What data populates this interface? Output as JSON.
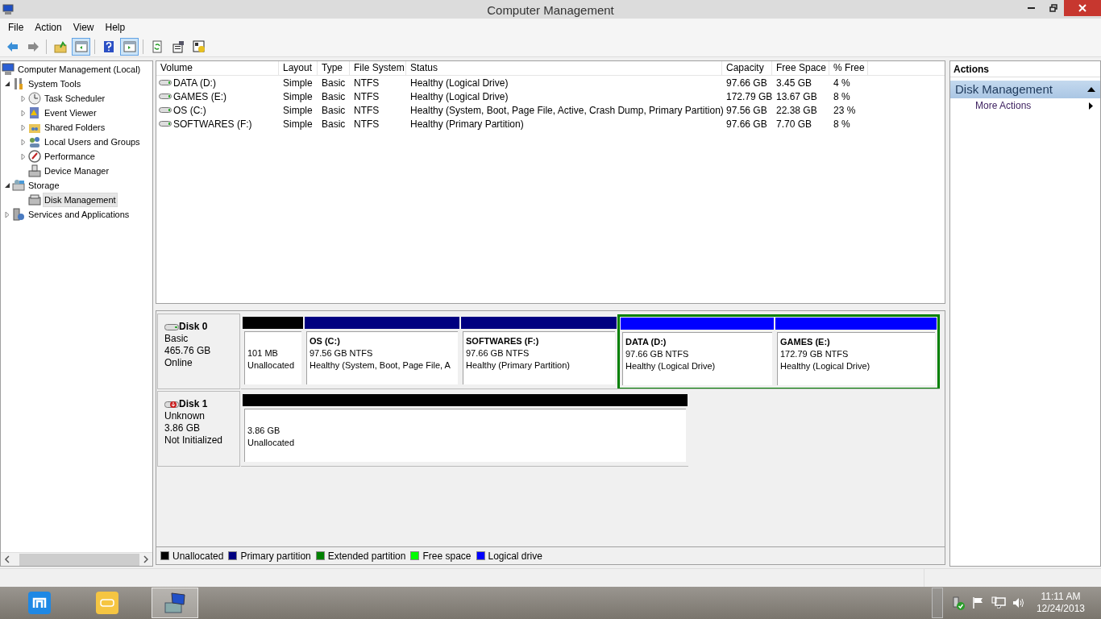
{
  "window": {
    "title": "Computer Management"
  },
  "menu": [
    "File",
    "Action",
    "View",
    "Help"
  ],
  "toolbar": [
    {
      "kind": "back",
      "pressed": false
    },
    {
      "kind": "forward",
      "pressed": false
    },
    {
      "kind": "sep"
    },
    {
      "kind": "up",
      "pressed": false
    },
    {
      "kind": "tree",
      "pressed": true
    },
    {
      "kind": "sep"
    },
    {
      "kind": "help",
      "pressed": false
    },
    {
      "kind": "pane",
      "pressed": true
    },
    {
      "kind": "sep"
    },
    {
      "kind": "refresh",
      "pressed": false
    },
    {
      "kind": "props",
      "pressed": false
    },
    {
      "kind": "settings",
      "pressed": false
    }
  ],
  "tree": [
    {
      "label": "Computer Management (Local)",
      "kind": "computer",
      "selected": false,
      "children": [
        {
          "label": "System Tools",
          "kind": "tools",
          "selected": false,
          "expanded": true,
          "children": [
            {
              "label": "Task Scheduler",
              "kind": "clock",
              "selected": false,
              "expanded": false
            },
            {
              "label": "Event Viewer",
              "kind": "log",
              "selected": false,
              "expanded": false
            },
            {
              "label": "Shared Folders",
              "kind": "folder",
              "selected": false,
              "expanded": false
            },
            {
              "label": "Local Users and Groups",
              "kind": "users",
              "selected": false,
              "expanded": false
            },
            {
              "label": "Performance",
              "kind": "gauge",
              "selected": false,
              "expanded": false
            },
            {
              "label": "Device Manager",
              "kind": "device",
              "selected": false
            }
          ]
        },
        {
          "label": "Storage",
          "kind": "storage",
          "selected": false,
          "expanded": true,
          "children": [
            {
              "label": "Disk Management",
              "kind": "disk",
              "selected": true
            }
          ]
        },
        {
          "label": "Services and Applications",
          "kind": "services",
          "selected": false,
          "expanded": false
        }
      ]
    }
  ],
  "volumes": {
    "columns": [
      "Volume",
      "Layout",
      "Type",
      "File System",
      "Status",
      "Capacity",
      "Free Space",
      "% Free"
    ],
    "rows": [
      [
        "DATA (D:)",
        "Simple",
        "Basic",
        "NTFS",
        "Healthy (Logical Drive)",
        "97.66 GB",
        "3.45 GB",
        "4 %"
      ],
      [
        "GAMES (E:)",
        "Simple",
        "Basic",
        "NTFS",
        "Healthy (Logical Drive)",
        "172.79 GB",
        "13.67 GB",
        "8 %"
      ],
      [
        "OS (C:)",
        "Simple",
        "Basic",
        "NTFS",
        "Healthy (System, Boot, Page File, Active, Crash Dump, Primary Partition)",
        "97.56 GB",
        "22.38 GB",
        "23 %"
      ],
      [
        "SOFTWARES (F:)",
        "Simple",
        "Basic",
        "NTFS",
        "Healthy (Primary Partition)",
        "97.66 GB",
        "7.70 GB",
        "8 %"
      ]
    ]
  },
  "disks": [
    {
      "name": "Disk 0",
      "kind": "online",
      "lines": [
        "Basic",
        "465.76 GB",
        "Online"
      ],
      "partitions": [
        {
          "kind": "unallocated",
          "lines": [
            "101 MB",
            "Unallocated"
          ]
        },
        {
          "kind": "primary",
          "title": "OS  (C:)",
          "lines": [
            "97.56 GB NTFS",
            "Healthy (System, Boot, Page File, A"
          ]
        },
        {
          "kind": "primary",
          "title": "SOFTWARES  (F:)",
          "lines": [
            "97.66 GB NTFS",
            "Healthy (Primary Partition)"
          ]
        },
        {
          "kind": "extended",
          "children": [
            {
              "kind": "logical",
              "title": "DATA  (D:)",
              "lines": [
                "97.66 GB NTFS",
                "Healthy (Logical Drive)"
              ]
            },
            {
              "kind": "logical",
              "title": "GAMES  (E:)",
              "lines": [
                "172.79 GB NTFS",
                "Healthy (Logical Drive)"
              ]
            }
          ]
        }
      ]
    },
    {
      "name": "Disk 1",
      "kind": "uninitialized",
      "lines": [
        "Unknown",
        "3.86 GB",
        "Not Initialized"
      ],
      "partitions": [
        {
          "kind": "unallocated",
          "lines": [
            "3.86 GB",
            "Unallocated"
          ]
        }
      ]
    }
  ],
  "legend": [
    {
      "label": "Unallocated",
      "color": "#000000"
    },
    {
      "label": "Primary partition",
      "color": "#000080"
    },
    {
      "label": "Extended partition",
      "color": "#008000"
    },
    {
      "label": "Free space",
      "color": "#00ff00"
    },
    {
      "label": "Logical drive",
      "color": "#0000ff"
    }
  ],
  "actions": {
    "title": "Actions",
    "sections": [
      {
        "label": "Disk Management",
        "expanded": true,
        "items": [
          "More Actions"
        ]
      }
    ]
  },
  "taskbar": {
    "apps": [
      {
        "kind": "browser",
        "active": false
      },
      {
        "kind": "plugin",
        "active": false
      },
      {
        "kind": "management",
        "active": true
      }
    ],
    "time": "11:11 AM",
    "date": "12/24/2013"
  }
}
